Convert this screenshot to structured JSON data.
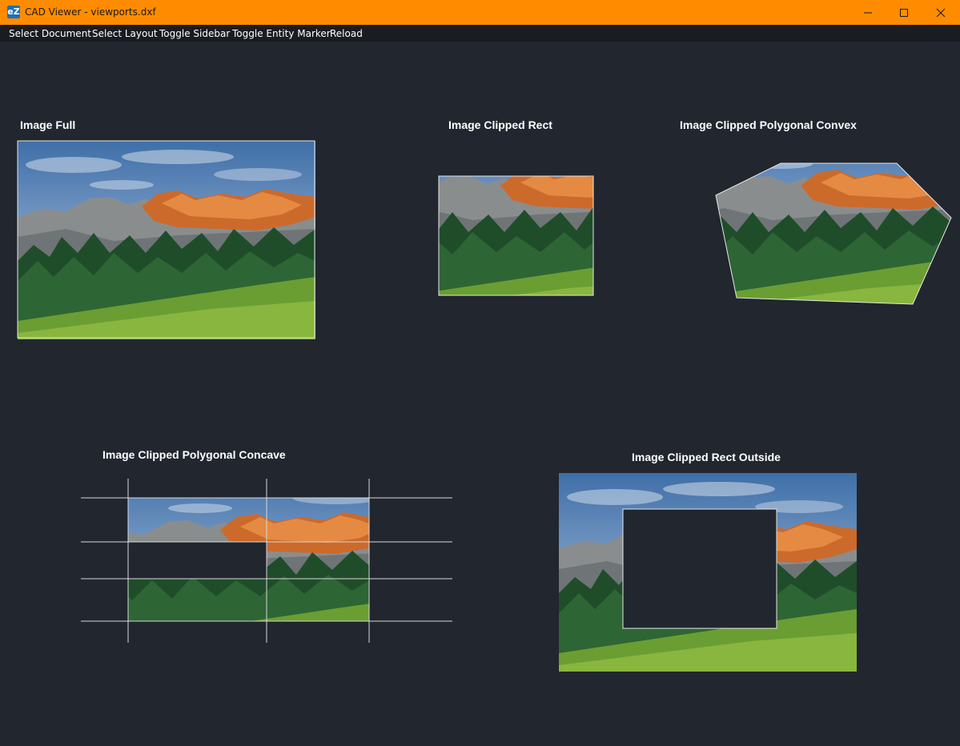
{
  "window": {
    "app_icon_text": "eZ",
    "title": "CAD Viewer - viewports.dxf"
  },
  "menu": {
    "items": [
      {
        "label": "Select Document"
      },
      {
        "label": "Select Layout"
      },
      {
        "label": "Toggle Sidebar"
      },
      {
        "label": "Toggle Entity Marker"
      },
      {
        "label": "Reload"
      }
    ]
  },
  "viewports": {
    "image_full": "Image Full",
    "image_clipped_rect": "Image Clipped Rect",
    "image_clipped_polygonal_convex": "Image Clipped Polygonal Convex",
    "image_clipped_polygonal_concave": "Image Clipped Polygonal Concave",
    "image_clipped_rect_outside": "Image Clipped Rect Outside"
  },
  "colors": {
    "titlebar": "#ff8c00",
    "background": "#21262f",
    "menubar": "#191c21"
  }
}
